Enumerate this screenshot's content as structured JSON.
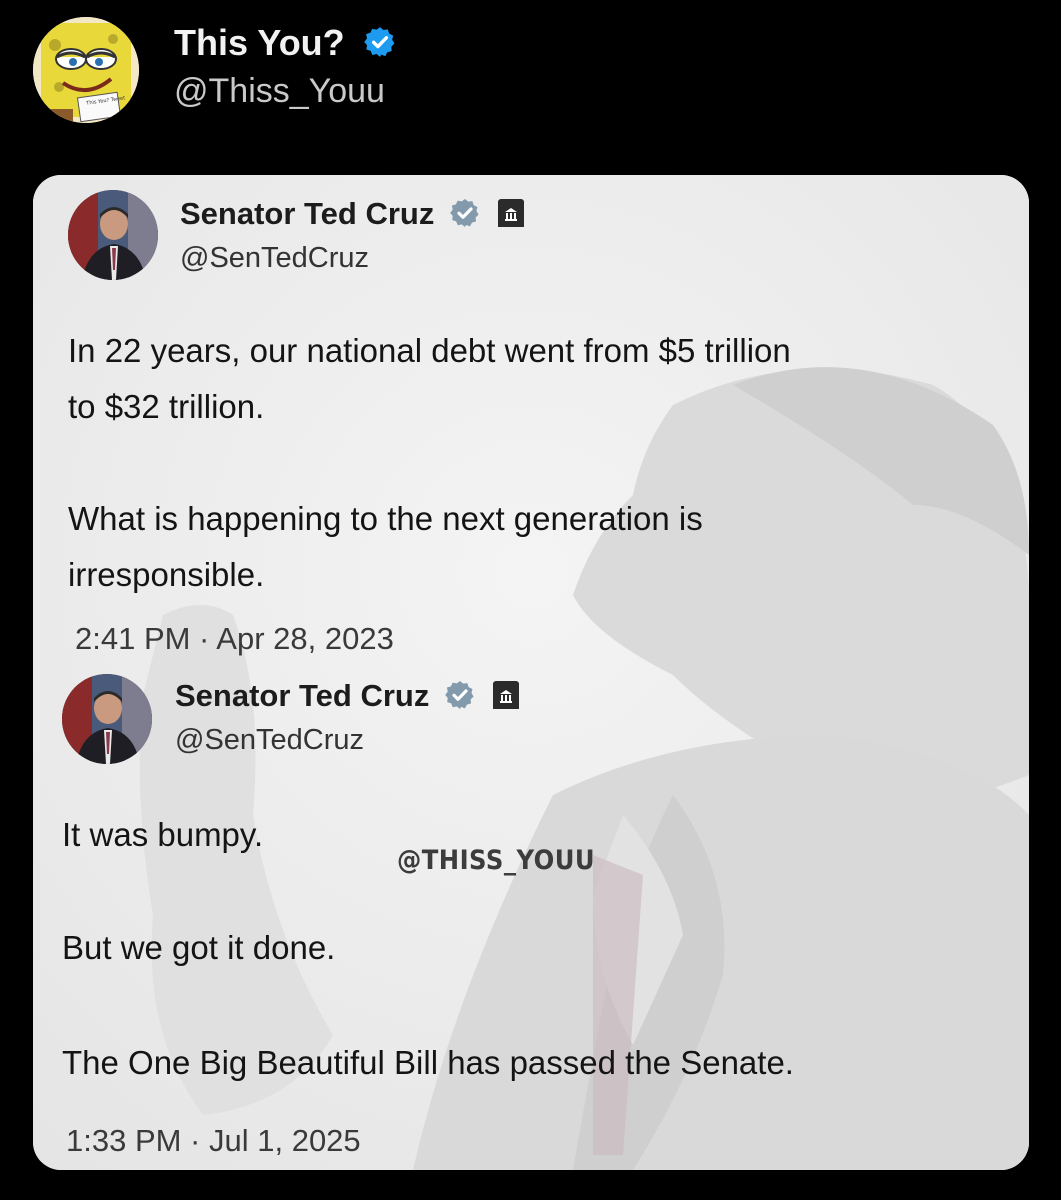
{
  "header": {
    "display_name": "This You?",
    "handle": "@Thiss_Youu",
    "avatar_icon": "spongebob-avatar-icon",
    "avatar_sign_text": "This You? Tweet"
  },
  "tweets": [
    {
      "name": "Senator Ted Cruz",
      "handle": "@SenTedCruz",
      "lines": [
        "In 22 years, our national debt went from $5 trillion",
        "to $32 trillion.",
        "",
        "What is happening to the next generation is",
        "irresponsible."
      ],
      "time": "2:41 PM · Apr 28, 2023"
    },
    {
      "name": "Senator Ted Cruz",
      "handle": "@SenTedCruz",
      "lines": [
        "It was bumpy.",
        "",
        "But we got it done.",
        "",
        "The One Big Beautiful Bill has passed the Senate."
      ],
      "time": "1:33 PM · Jul 1, 2025"
    }
  ],
  "watermark": "@THISS_YOUU",
  "colors": {
    "background": "#000000",
    "verified_blue": "#1d9bf0",
    "verified_gray": "#829aab",
    "card": "#ececec"
  }
}
